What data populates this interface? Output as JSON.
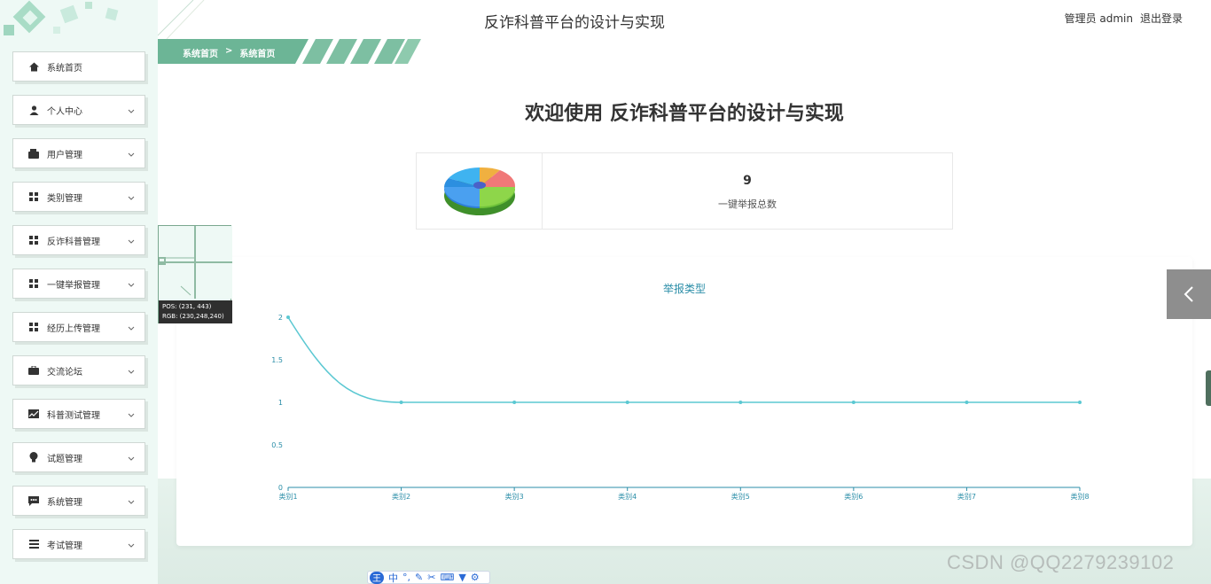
{
  "app": {
    "title": "反诈科普平台的设计与实现",
    "welcome": "欢迎使用 反诈科普平台的设计与实现",
    "user_label": "管理员 admin",
    "logout_label": "退出登录"
  },
  "breadcrumb": {
    "home": "系统首页",
    "separator": ">",
    "current": "系统首页"
  },
  "sidebar": {
    "items": [
      {
        "label": "系统首页",
        "icon": "home-icon"
      },
      {
        "label": "个人中心",
        "icon": "user-icon"
      },
      {
        "label": "用户管理",
        "icon": "wallet-icon"
      },
      {
        "label": "类别管理",
        "icon": "grid-icon"
      },
      {
        "label": "反诈科普管理",
        "icon": "grid-icon"
      },
      {
        "label": "一键举报管理",
        "icon": "grid-icon"
      },
      {
        "label": "经历上传管理",
        "icon": "grid-icon"
      },
      {
        "label": "交流论坛",
        "icon": "briefcase-icon"
      },
      {
        "label": "科普测试管理",
        "icon": "chart-icon"
      },
      {
        "label": "试题管理",
        "icon": "bulb-icon"
      },
      {
        "label": "系统管理",
        "icon": "message-icon"
      },
      {
        "label": "考试管理",
        "icon": "list-icon"
      }
    ]
  },
  "stat": {
    "value": "9",
    "label": "一键举报总数"
  },
  "picker": {
    "pos": "POS: (231, 443)",
    "rgb": "RGB: (230,248,240)"
  },
  "ime": {
    "lang": "中"
  },
  "watermark": "CSDN @QQ2279239102",
  "chart_data": {
    "type": "line",
    "title": "举报类型",
    "categories": [
      "类别1",
      "类别2",
      "类别3",
      "类别4",
      "类别5",
      "类别6",
      "类别7",
      "类别8"
    ],
    "values": [
      2,
      1,
      1,
      1,
      1,
      1,
      1,
      1
    ],
    "y_ticks": [
      "0",
      "0.5",
      "1",
      "1.5",
      "2"
    ],
    "ylim": [
      0,
      2
    ],
    "smooth": true,
    "color": "#5bc8d2",
    "axis_color": "#2b8ea8"
  }
}
